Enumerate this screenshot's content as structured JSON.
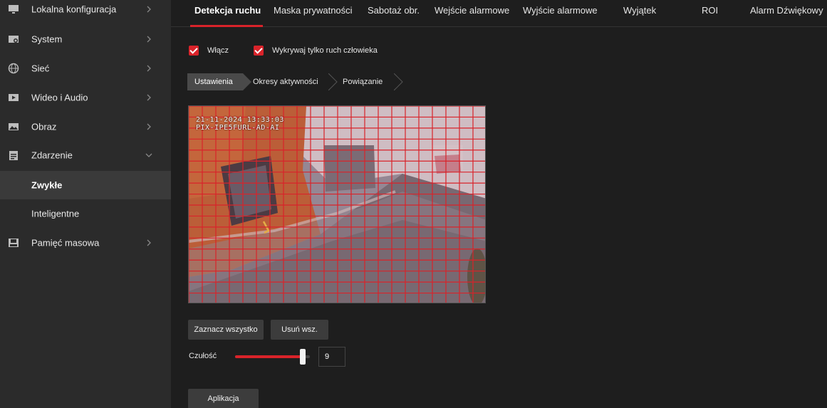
{
  "sidebar": {
    "items": [
      {
        "label": "Lokalna konfiguracja",
        "icon": "monitor-icon",
        "expandable": true
      },
      {
        "label": "System",
        "icon": "system-icon",
        "expandable": true
      },
      {
        "label": "Sieć",
        "icon": "network-globe-icon",
        "expandable": true
      },
      {
        "label": "Wideo i Audio",
        "icon": "video-play-icon",
        "expandable": true
      },
      {
        "label": "Obraz",
        "icon": "image-icon",
        "expandable": true
      },
      {
        "label": "Zdarzenie",
        "icon": "calendar-icon",
        "expanded": true
      },
      {
        "label": "Zwykłe",
        "active": true
      },
      {
        "label": "Inteligentne"
      },
      {
        "label": "Pamięć masowa",
        "icon": "storage-icon",
        "expandable": true
      }
    ]
  },
  "tabs": [
    {
      "label": "Detekcja ruchu",
      "active": true
    },
    {
      "label": "Maska prywatności"
    },
    {
      "label": "Sabotaż obr."
    },
    {
      "label": "Wejście alarmowe"
    },
    {
      "label": "Wyjście alarmowe"
    },
    {
      "label": "Wyjątek"
    },
    {
      "label": "ROI"
    },
    {
      "label": "Alarm Dźwiękowy"
    }
  ],
  "options": {
    "enable_label": "Włącz",
    "enable_checked": true,
    "human_only_label": "Wykrywaj tylko ruch człowieka",
    "human_only_checked": true
  },
  "steps": [
    "Ustawienia",
    "Okresy aktywności",
    "Powiązanie"
  ],
  "video": {
    "osd_line1": "21-11-2024 13:33:03",
    "osd_line2": "PIX-IPE5FURL-AD-AI"
  },
  "buttons": {
    "select_all": "Zaznacz wszystko",
    "clear_all": "Usuń wsz.",
    "apply": "Aplikacja"
  },
  "sensitivity": {
    "label": "Czułość",
    "value": "9",
    "level_fraction": 0.9
  },
  "colors": {
    "accent": "#d9232a",
    "background": "#1e1e1e",
    "sidebar": "#2b2b2b"
  }
}
